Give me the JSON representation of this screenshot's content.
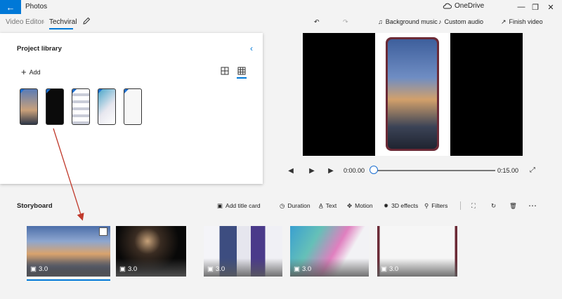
{
  "window": {
    "title": "Photos",
    "onedrive_label": "OneDrive"
  },
  "toolbar": {
    "breadcrumb_root": "Video Editor",
    "breadcrumb_project": "Techviral",
    "background_music": "Background music",
    "custom_audio": "Custom audio",
    "finish_video": "Finish video"
  },
  "library": {
    "title": "Project library",
    "add_label": "Add",
    "thumbnails": [
      {
        "name": "mountain-day",
        "color": "#6e88b6"
      },
      {
        "name": "mountain-night",
        "color": "#111111"
      },
      {
        "name": "settings-screens",
        "color": "#d9dbe3"
      },
      {
        "name": "colorful-screen",
        "color": "#7cb8c8"
      },
      {
        "name": "blank-screen",
        "color": "#f4f4f4"
      }
    ]
  },
  "player": {
    "current_time": "0:00.00",
    "end_time": "0:15.00",
    "progress": 0
  },
  "storyboard": {
    "title": "Storyboard",
    "add_title_card": "Add title card",
    "duration": "Duration",
    "text": "Text",
    "motion": "Motion",
    "effects_3d": "3D effects",
    "filters": "Filters",
    "clips": [
      {
        "duration": "3.0"
      },
      {
        "duration": "3.0"
      },
      {
        "duration": "3.0"
      },
      {
        "duration": "3.0"
      },
      {
        "duration": "3.0"
      }
    ]
  },
  "colors": {
    "accent": "#0078d7",
    "annotation_arrow": "#c0392b"
  }
}
